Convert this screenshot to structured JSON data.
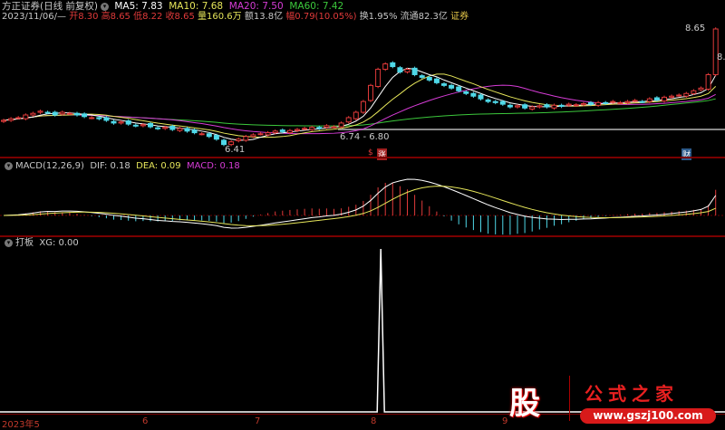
{
  "header": {
    "title": "方正证券(日线 前复权)",
    "ma": [
      {
        "label": "MA5: 7.83",
        "color": "#ffffff"
      },
      {
        "label": "MA10: 7.68",
        "color": "#e6e65a"
      },
      {
        "label": "MA20: 7.50",
        "color": "#d63cd6"
      },
      {
        "label": "MA60: 7.42",
        "color": "#3cc83c"
      }
    ],
    "date": "2023/11/06/—",
    "open": "开8.30",
    "high": "高8.65",
    "low": "低8.22",
    "close": "收8.65",
    "volume": "量160.6万",
    "amount": "额13.8亿",
    "change": "幅0.79(10.05%)",
    "turnover": "换1.95%",
    "float": "流通82.3亿",
    "sector": "证券"
  },
  "annotations": {
    "low_label": "6.41",
    "range_label": "6.74 - 6.80",
    "high_label": "8.65",
    "right_label": "8.",
    "dollar_mark": "$",
    "zhang_mark": "涨",
    "cai_mark": "财"
  },
  "macd": {
    "title": "MACD(12,26,9)",
    "dif": "DIF: 0.18",
    "dea": "DEA: 0.09",
    "macd": "MACD: 0.18"
  },
  "xg": {
    "title": "打板",
    "value": "XG: 0.00"
  },
  "axis": {
    "labels": [
      "2023年5",
      "6",
      "7",
      "8",
      "9"
    ]
  },
  "logo": {
    "char": "股",
    "name": "公式之家",
    "url": "www.gszj100.com"
  },
  "colors": {
    "up": "#e03a3a",
    "down": "#4fd8e8",
    "ma5": "#ffffff",
    "ma10": "#e6e65a",
    "ma20": "#d63cd6",
    "ma60": "#3cc83c"
  },
  "chart_data": {
    "type": "candlestick",
    "closes": [
      6.95,
      6.98,
      7.0,
      7.05,
      7.08,
      7.12,
      7.1,
      7.05,
      7.1,
      7.08,
      7.05,
      7.02,
      7.0,
      6.98,
      6.95,
      6.9,
      6.92,
      6.88,
      6.85,
      6.87,
      6.83,
      6.8,
      6.82,
      6.78,
      6.8,
      6.75,
      6.72,
      6.7,
      6.65,
      6.6,
      6.5,
      6.55,
      6.6,
      6.65,
      6.68,
      6.7,
      6.72,
      6.75,
      6.74,
      6.76,
      6.78,
      6.8,
      6.82,
      6.8,
      6.85,
      6.83,
      6.9,
      7.0,
      7.1,
      7.3,
      7.6,
      7.9,
      8.0,
      7.95,
      7.85,
      7.9,
      7.8,
      7.75,
      7.7,
      7.65,
      7.6,
      7.55,
      7.5,
      7.45,
      7.4,
      7.35,
      7.3,
      7.28,
      7.25,
      7.2,
      7.22,
      7.18,
      7.2,
      7.22,
      7.2,
      7.23,
      7.21,
      7.25,
      7.24,
      7.26,
      7.25,
      7.28,
      7.27,
      7.3,
      7.28,
      7.3,
      7.32,
      7.3,
      7.35,
      7.33,
      7.38,
      7.4,
      7.42,
      7.45,
      7.5,
      7.55,
      7.8,
      8.65
    ],
    "xg_signal_index": 52,
    "price_range": [
      6.41,
      8.65
    ]
  }
}
